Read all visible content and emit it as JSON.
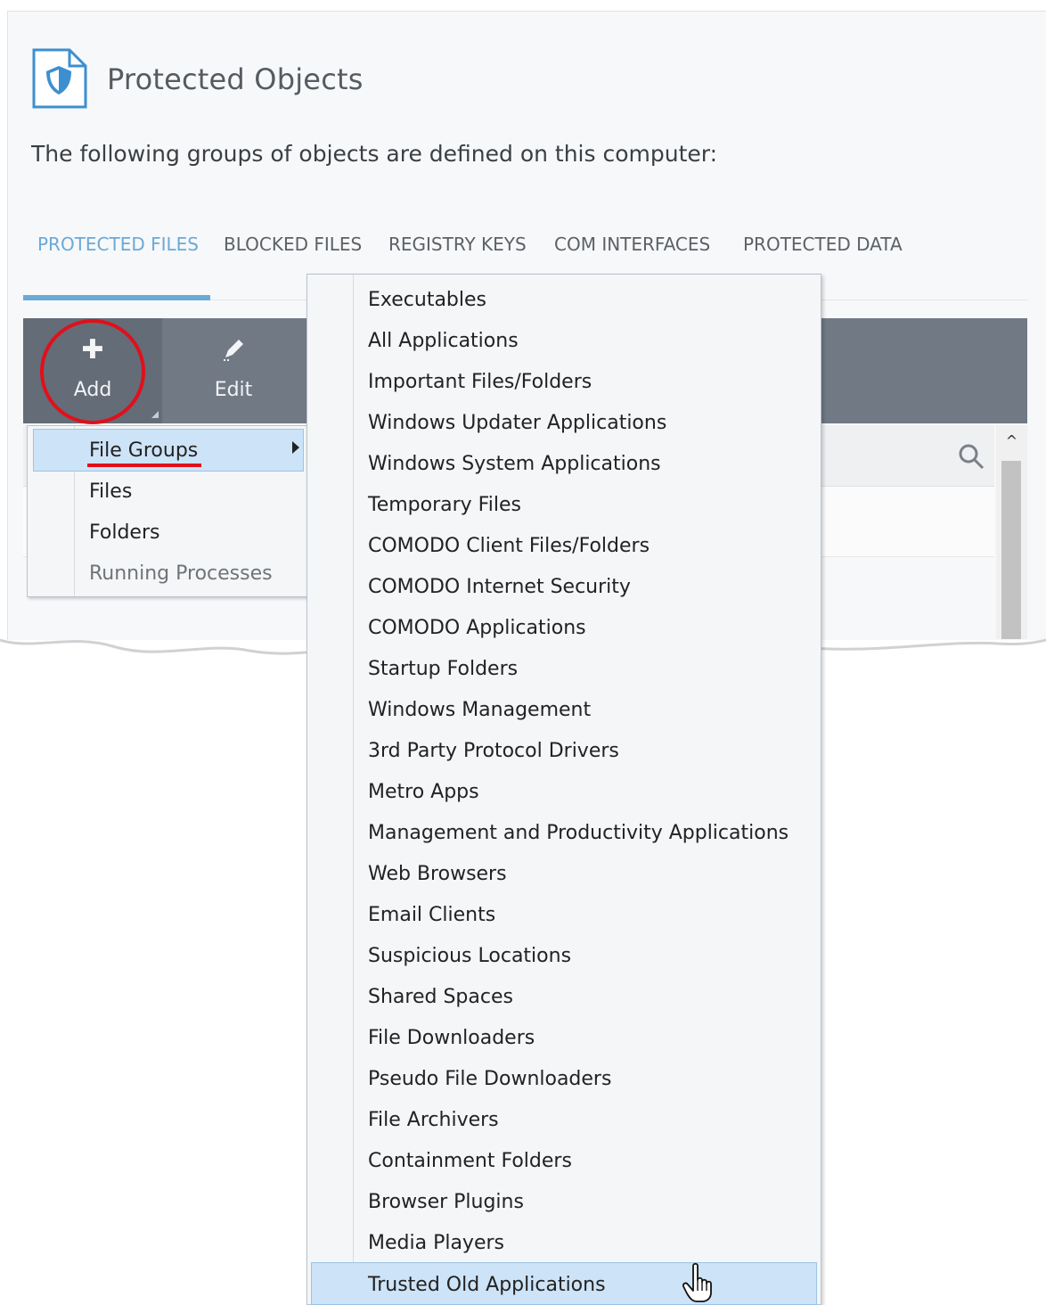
{
  "header": {
    "title": "Protected Objects",
    "subtitle": "The following groups of objects are defined on this computer:"
  },
  "tabs": [
    {
      "label": "PROTECTED FILES",
      "active": true
    },
    {
      "label": "BLOCKED FILES",
      "active": false
    },
    {
      "label": "REGISTRY KEYS",
      "active": false
    },
    {
      "label": "COM INTERFACES",
      "active": false
    },
    {
      "label": "PROTECTED DATA",
      "active": false
    }
  ],
  "toolbar": {
    "add_label": "Add",
    "edit_label": "Edit"
  },
  "add_menu": {
    "items": [
      {
        "label": "File Groups",
        "selected": true,
        "has_submenu": true
      },
      {
        "label": "Files"
      },
      {
        "label": "Folders"
      },
      {
        "label": "Running Processes",
        "disabled": true
      }
    ]
  },
  "file_groups_submenu": {
    "items": [
      "Executables",
      "All Applications",
      "Important Files/Folders",
      "Windows Updater Applications",
      "Windows System Applications",
      "Temporary Files",
      "COMODO Client Files/Folders",
      "COMODO Internet Security",
      "COMODO Applications",
      "Startup Folders",
      "Windows Management",
      "3rd Party Protocol Drivers",
      "Metro Apps",
      "Management and Productivity Applications",
      "Web Browsers",
      "Email Clients",
      "Suspicious Locations",
      "Shared Spaces",
      "File Downloaders",
      "Pseudo File Downloaders",
      "File Archivers",
      "Containment Folders",
      "Browser Plugins",
      "Media Players",
      "Trusted Old Applications"
    ],
    "hovered_index": 24
  },
  "colors": {
    "accent": "#6aaad8",
    "toolbar": "#717985",
    "highlight": "#e0101a",
    "selection": "#cde3f7"
  }
}
